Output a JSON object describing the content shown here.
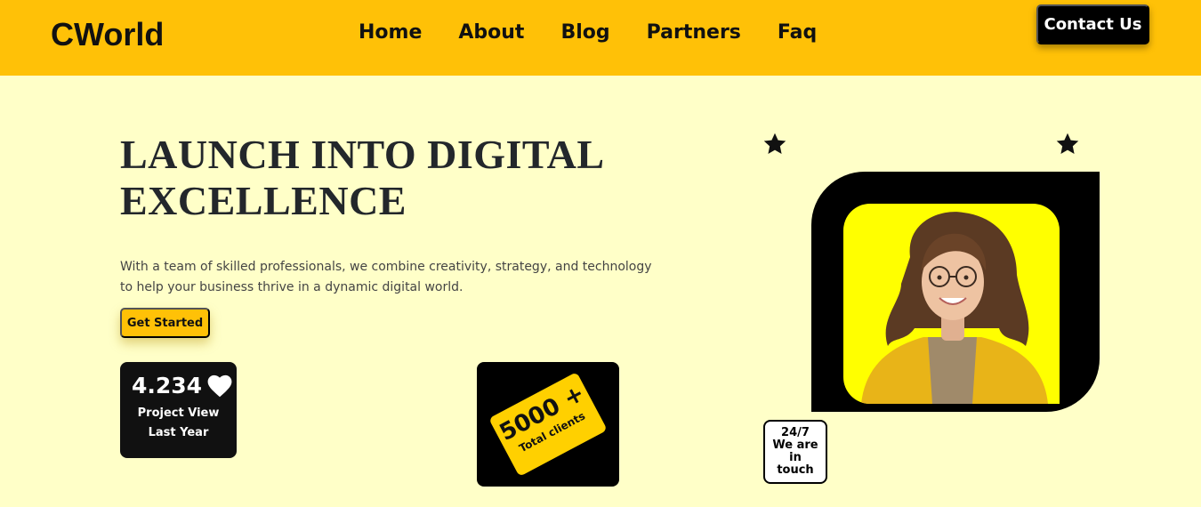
{
  "header": {
    "brand": "CWorld",
    "nav": [
      "Home",
      "About",
      "Blog",
      "Partners",
      "Faq"
    ],
    "contact_label": "Contact Us"
  },
  "hero": {
    "title_line1": "LAUNCH INTO DIGITAL",
    "title_line2": "EXCELLENCE",
    "description": "With a team of skilled professionals, we combine creativity, strategy, and technology to help your business thrive in a dynamic digital world.",
    "cta_label": "Get Started"
  },
  "stats": {
    "value": "4.234",
    "icon": "heart-icon",
    "label_line1": "Project View",
    "label_line2": "Last Year"
  },
  "clients": {
    "count": "5000 +",
    "label": "Total clients"
  },
  "badge": {
    "line1": "24/7",
    "line2": "We are",
    "line3": "in",
    "line4": "touch"
  },
  "colors": {
    "accent": "#ffc107",
    "background": "#ffffc8",
    "dark": "#111111",
    "photo_bg": "#ffff00"
  }
}
